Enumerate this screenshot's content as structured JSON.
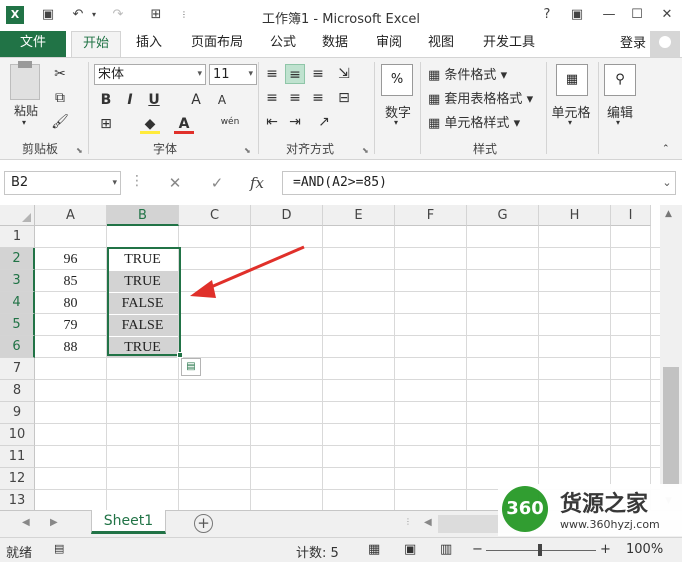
{
  "window": {
    "title": "工作簿1 - Microsoft Excel",
    "app_icon": "X",
    "help": "?",
    "ribbon_display": "▣",
    "minimize": "—",
    "restore": "☐",
    "close": "✕"
  },
  "qat": {
    "save": "▣",
    "undo": "↶",
    "redo": "↷"
  },
  "tabs": [
    "文件",
    "开始",
    "插入",
    "页面布局",
    "公式",
    "数据",
    "审阅",
    "视图",
    "开发工具"
  ],
  "login": "登录",
  "ribbon": {
    "clipboard": {
      "paste": "粘贴",
      "label": "剪贴板"
    },
    "font": {
      "name": "宋体",
      "size": "11",
      "bold": "B",
      "italic": "I",
      "underline": "U",
      "grow": "A",
      "shrink": "A",
      "wen": "wén",
      "label": "字体"
    },
    "alignment": {
      "label": "对齐方式"
    },
    "number": {
      "button": "数字",
      "percent": "%"
    },
    "styles": {
      "conditional": "条件格式",
      "table": "套用表格格式",
      "cell": "单元格样式",
      "label": "样式"
    },
    "cells": {
      "button": "单元格"
    },
    "editing": {
      "button": "编辑"
    }
  },
  "formula_bar": {
    "name_box": "B2",
    "cancel": "✕",
    "enter": "✓",
    "fx": "fx",
    "formula": "=AND(A2>=85)"
  },
  "sheet": {
    "columns": [
      "A",
      "B",
      "C",
      "D",
      "E",
      "F",
      "G",
      "H",
      "I"
    ],
    "rows": [
      "1",
      "2",
      "3",
      "4",
      "5",
      "6",
      "7",
      "8",
      "9",
      "10",
      "11",
      "12",
      "13"
    ],
    "colA": [
      "96",
      "85",
      "80",
      "79",
      "88"
    ],
    "colB": [
      "TRUE",
      "TRUE",
      "FALSE",
      "FALSE",
      "TRUE"
    ]
  },
  "sheet_tabs": {
    "active": "Sheet1",
    "add": "+"
  },
  "status": {
    "ready": "就绪",
    "count": "计数: 5",
    "zoom": "100%"
  },
  "watermark": {
    "badge": "360",
    "name": "货源之家",
    "url": "www.360hyzj.com"
  },
  "colors": {
    "accent": "#217346",
    "arrow": "#e0302a"
  }
}
